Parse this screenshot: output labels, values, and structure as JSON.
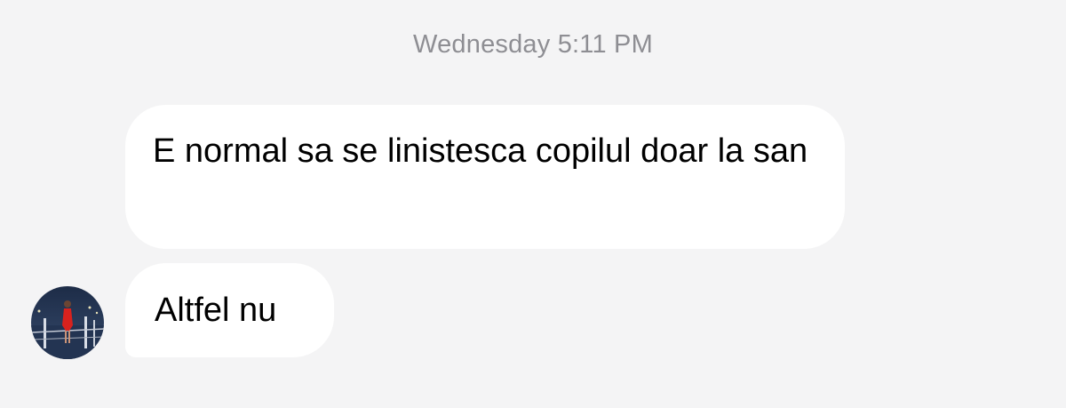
{
  "conversation": {
    "timestamp": "Wednesday 5:11 PM",
    "messages": [
      {
        "text": "E normal sa se linistesca copilul doar la san"
      },
      {
        "text": "Altfel nu"
      }
    ]
  },
  "sender": {
    "avatar": "contact-avatar-photo"
  },
  "colors": {
    "background": "#f4f4f5",
    "bubble": "#ffffff",
    "timestamp": "#8e8e93",
    "message_text": "#000000"
  }
}
